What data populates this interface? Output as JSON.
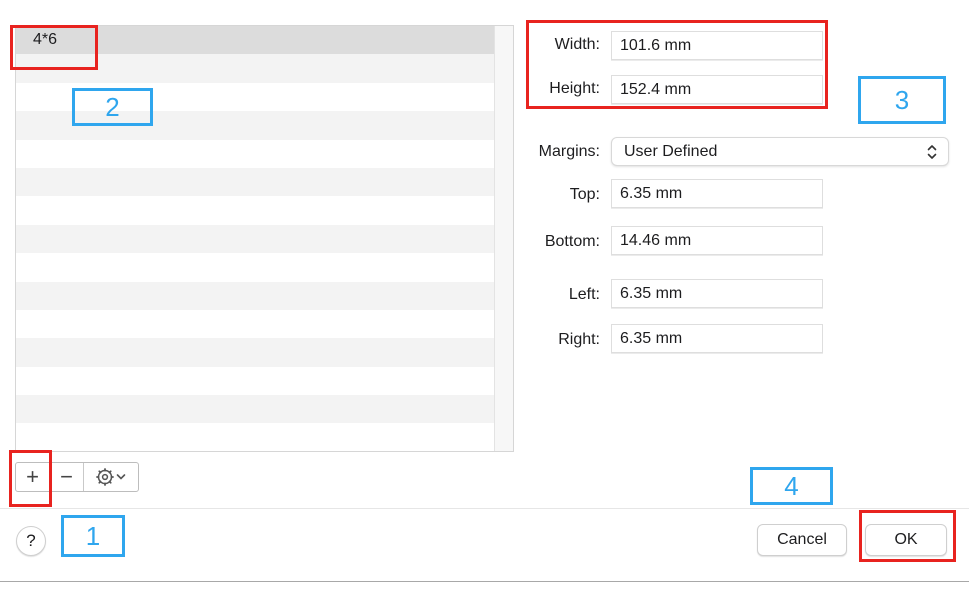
{
  "list": {
    "items": [
      "4*6"
    ],
    "row_count": 15
  },
  "toolbar": {
    "add_label": "+",
    "remove_label": "−",
    "more_chevron": "⌄"
  },
  "help": {
    "label": "?"
  },
  "form": {
    "width_label": "Width:",
    "width_value": "101.6 mm",
    "height_label": "Height:",
    "height_value": "152.4 mm",
    "margins_label": "Margins:",
    "margins_value": "User Defined",
    "top_label": "Top:",
    "top_value": "6.35 mm",
    "bottom_label": "Bottom:",
    "bottom_value": "14.46 mm",
    "left_label": "Left:",
    "left_value": "6.35 mm",
    "right_label": "Right:",
    "right_value": "6.35 mm"
  },
  "buttons": {
    "cancel": "Cancel",
    "ok": "OK"
  },
  "annotations": {
    "label_1": "1",
    "label_2": "2",
    "label_3": "3",
    "label_4": "4",
    "red_color": "#e8231f",
    "blue_color": "#2fa6ee"
  }
}
